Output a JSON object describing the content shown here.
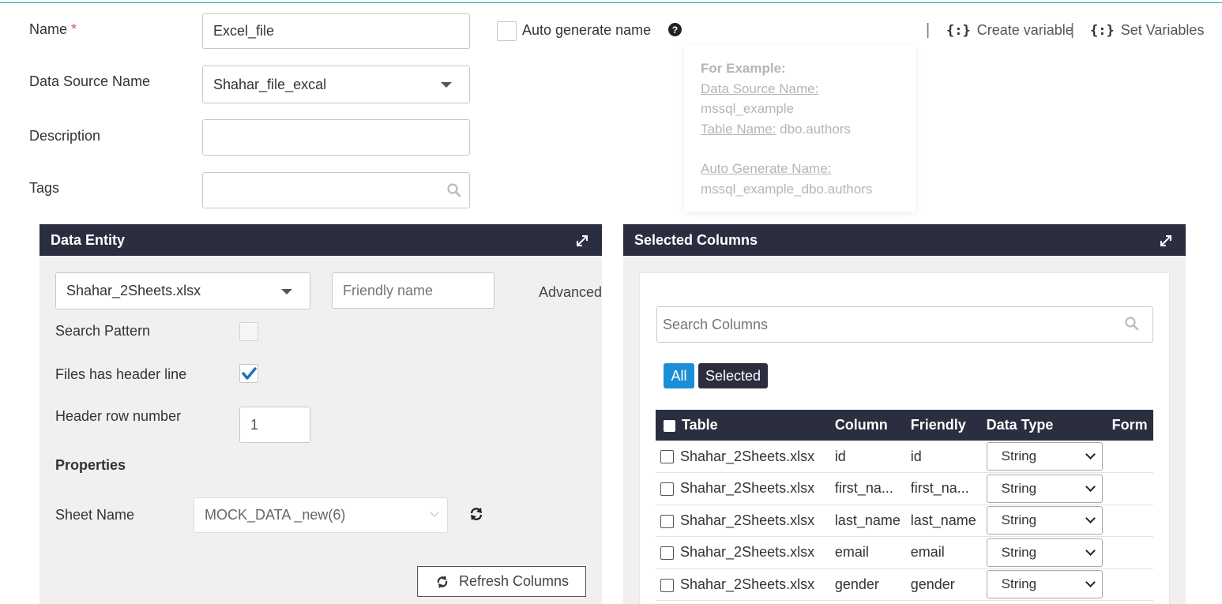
{
  "form": {
    "name_label": "Name",
    "name_required": "*",
    "name_value": "Excel_file",
    "auto_generate_label": "Auto generate name",
    "datasource_label": "Data Source Name",
    "datasource_value": "Shahar_file_excal",
    "description_label": "Description",
    "description_value": "",
    "tags_label": "Tags",
    "tags_value": ""
  },
  "toolbar": {
    "separator": "|",
    "create_variable": "Create variable",
    "set_variables": "Set Variables",
    "variable_icon_glyph": "{:}"
  },
  "tooltip": {
    "title": "For Example:",
    "ds_label": "Data Source Name:",
    "ds_value": "mssql_example",
    "table_label": "Table Name:",
    "table_value": "dbo.authors",
    "auto_label": "Auto Generate Name:",
    "auto_value": "mssql_example_dbo.authors"
  },
  "data_entity": {
    "title": "Data Entity",
    "file_value": "Shahar_2Sheets.xlsx",
    "friendly_placeholder": "Friendly name",
    "advanced_label": "Advanced",
    "search_pattern_label": "Search Pattern",
    "search_pattern_checked": false,
    "header_line_label": "Files has header line",
    "header_line_checked": true,
    "header_row_label": "Header row number",
    "header_row_value": "1",
    "properties_label": "Properties",
    "sheet_name_label": "Sheet Name",
    "sheet_name_value": "MOCK_DATA _new(6)",
    "refresh_columns_label": "Refresh Columns"
  },
  "selected_columns": {
    "title": "Selected Columns",
    "search_placeholder": "Search Columns",
    "filter_all": "All",
    "filter_selected": "Selected",
    "headers": [
      "Table",
      "Column",
      "Friendly",
      "Data Type",
      "Form"
    ],
    "rows": [
      {
        "table": "Shahar_2Sheets.xlsx",
        "column": "id",
        "friendly": "id",
        "type": "String"
      },
      {
        "table": "Shahar_2Sheets.xlsx",
        "column": "first_na...",
        "friendly": "first_na...",
        "type": "String"
      },
      {
        "table": "Shahar_2Sheets.xlsx",
        "column": "last_name",
        "friendly": "last_name",
        "type": "String"
      },
      {
        "table": "Shahar_2Sheets.xlsx",
        "column": "email",
        "friendly": "email",
        "type": "String"
      },
      {
        "table": "Shahar_2Sheets.xlsx",
        "column": "gender",
        "friendly": "gender",
        "type": "String"
      }
    ]
  },
  "colors": {
    "header_bg": "#2b2e3f",
    "accent_blue": "#1a8fd8",
    "check_blue": "#1f6fb5",
    "top_line": "#2aa7a3"
  }
}
